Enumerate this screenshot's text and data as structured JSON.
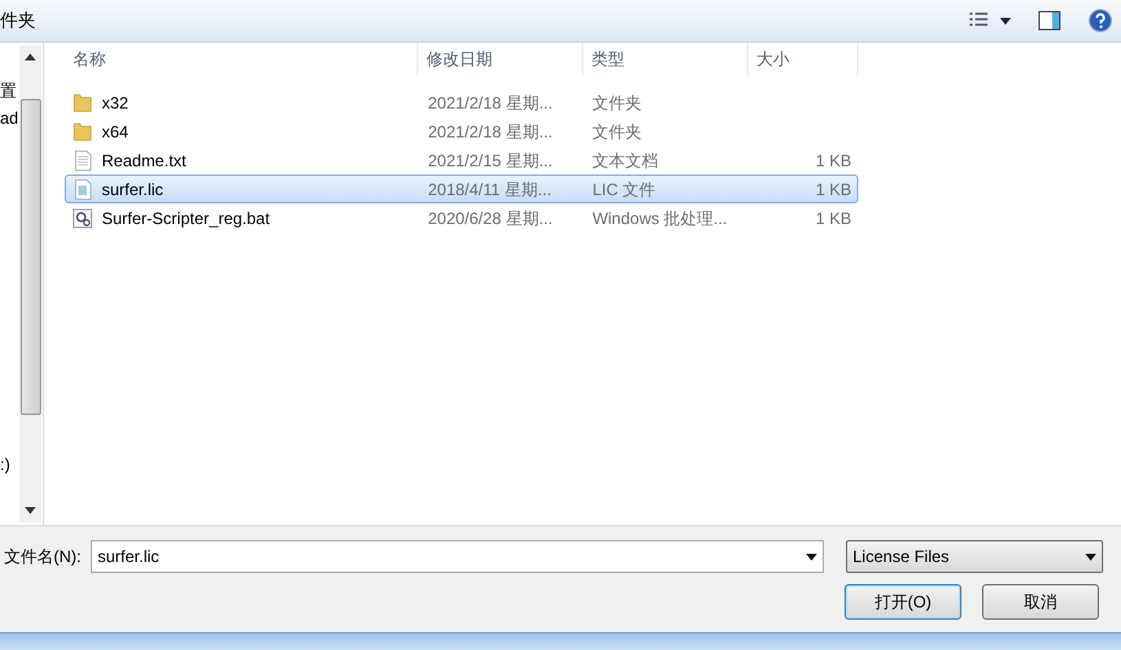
{
  "toolbar": {
    "title": "件夹"
  },
  "nav_pane": {
    "items": [
      "置",
      "ad",
      ":)"
    ]
  },
  "table": {
    "columns": [
      "名称",
      "修改日期",
      "类型",
      "大小"
    ],
    "rows": [
      {
        "kind": "folder",
        "name": "x32",
        "date": "2021/2/18 星期...",
        "type": "文件夹",
        "size": "",
        "selected": false
      },
      {
        "kind": "folder",
        "name": "x64",
        "date": "2021/2/18 星期...",
        "type": "文件夹",
        "size": "",
        "selected": false
      },
      {
        "kind": "text",
        "name": "Readme.txt",
        "date": "2021/2/15 星期...",
        "type": "文本文档",
        "size": "1 KB",
        "selected": false
      },
      {
        "kind": "file",
        "name": "surfer.lic",
        "date": "2018/4/11 星期...",
        "type": "LIC 文件",
        "size": "1 KB",
        "selected": true
      },
      {
        "kind": "batch",
        "name": "Surfer-Scripter_reg.bat",
        "date": "2020/6/28 星期...",
        "type": "Windows 批处理...",
        "size": "1 KB",
        "selected": false
      }
    ]
  },
  "filename": {
    "label": "文件名(N):",
    "value": "surfer.lic"
  },
  "filter": {
    "value": "License Files"
  },
  "buttons": [
    "打开(O)",
    "取消"
  ]
}
